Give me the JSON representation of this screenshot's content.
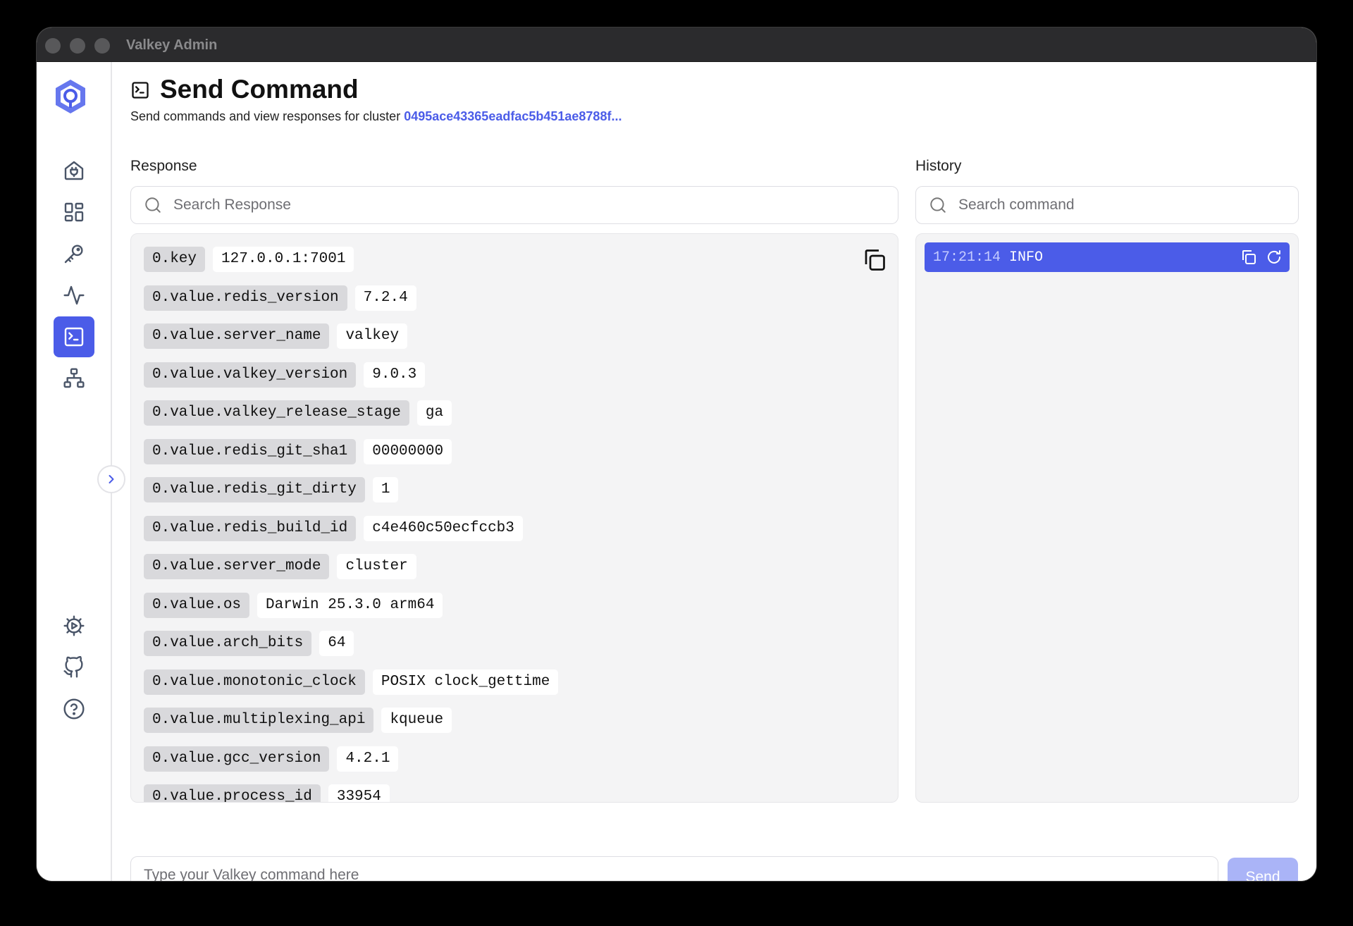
{
  "window": {
    "title": "Valkey Admin"
  },
  "header": {
    "title": "Send Command",
    "subtitle_prefix": "Send commands and view responses for cluster ",
    "cluster_id": "0495ace43365eadfac5b451ae8788f..."
  },
  "response": {
    "label": "Response",
    "search_placeholder": "Search Response",
    "rows": [
      {
        "key": "0.key",
        "value": "127.0.0.1:7001"
      },
      {
        "key": "0.value.redis_version",
        "value": "7.2.4"
      },
      {
        "key": "0.value.server_name",
        "value": "valkey"
      },
      {
        "key": "0.value.valkey_version",
        "value": "9.0.3"
      },
      {
        "key": "0.value.valkey_release_stage",
        "value": "ga"
      },
      {
        "key": "0.value.redis_git_sha1",
        "value": "00000000"
      },
      {
        "key": "0.value.redis_git_dirty",
        "value": "1"
      },
      {
        "key": "0.value.redis_build_id",
        "value": "c4e460c50ecfccb3"
      },
      {
        "key": "0.value.server_mode",
        "value": "cluster"
      },
      {
        "key": "0.value.os",
        "value": "Darwin 25.3.0 arm64"
      },
      {
        "key": "0.value.arch_bits",
        "value": "64"
      },
      {
        "key": "0.value.monotonic_clock",
        "value": "POSIX clock_gettime"
      },
      {
        "key": "0.value.multiplexing_api",
        "value": "kqueue"
      },
      {
        "key": "0.value.gcc_version",
        "value": "4.2.1"
      },
      {
        "key": "0.value.process_id",
        "value": "33954"
      }
    ]
  },
  "history": {
    "label": "History",
    "search_placeholder": "Search command",
    "items": [
      {
        "time": "17:21:14",
        "command": "INFO"
      }
    ]
  },
  "command": {
    "placeholder": "Type your Valkey command here",
    "send_label": "Send"
  },
  "colors": {
    "accent": "#4b5ce8",
    "send_disabled": "#aab4f7",
    "panel_bg": "#f4f4f5"
  },
  "icons": {
    "nav": [
      "connection-icon",
      "dashboard-icon",
      "key-icon",
      "activity-icon",
      "terminal-icon",
      "cluster-topology-icon",
      "settings-icon",
      "github-icon",
      "help-icon"
    ]
  }
}
